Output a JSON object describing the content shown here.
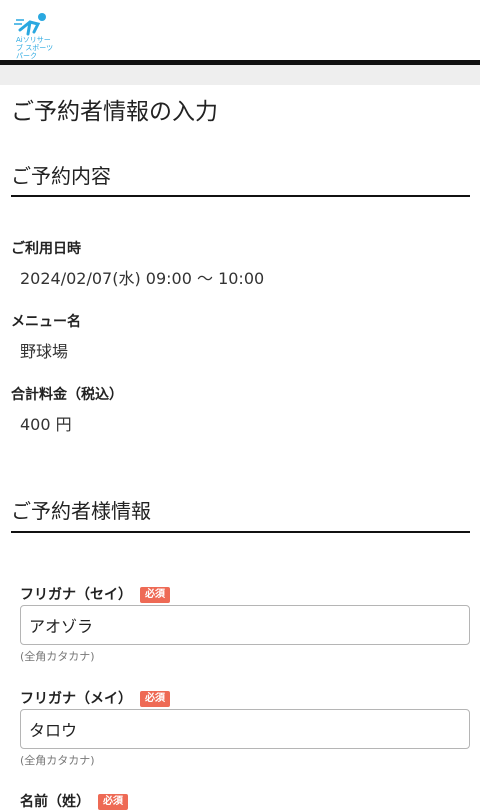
{
  "header": {
    "logo_text": "Aiソリサーブ スポーツパーク"
  },
  "page": {
    "title": "ご予約者情報の入力"
  },
  "reservation": {
    "section_title": "ご予約内容",
    "datetime_label": "ご利用日時",
    "datetime_value": "2024/02/07(水) 09:00 〜 10:00",
    "menu_label": "メニュー名",
    "menu_value": "野球場",
    "total_label": "合計料金（税込）",
    "total_value": "400 円"
  },
  "booker": {
    "section_title": "ご予約者様情報",
    "fields": [
      {
        "label": "フリガナ（セイ）",
        "required": "必須",
        "value": "アオゾラ",
        "hint": "(全角カタカナ)"
      },
      {
        "label": "フリガナ（メイ）",
        "required": "必須",
        "value": "タロウ",
        "hint": "(全角カタカナ)"
      },
      {
        "label": "名前（姓）",
        "required": "必須"
      }
    ]
  },
  "colors": {
    "accent": "#2aa8e0",
    "badge": "#ee6a55",
    "rule": "#111111"
  }
}
